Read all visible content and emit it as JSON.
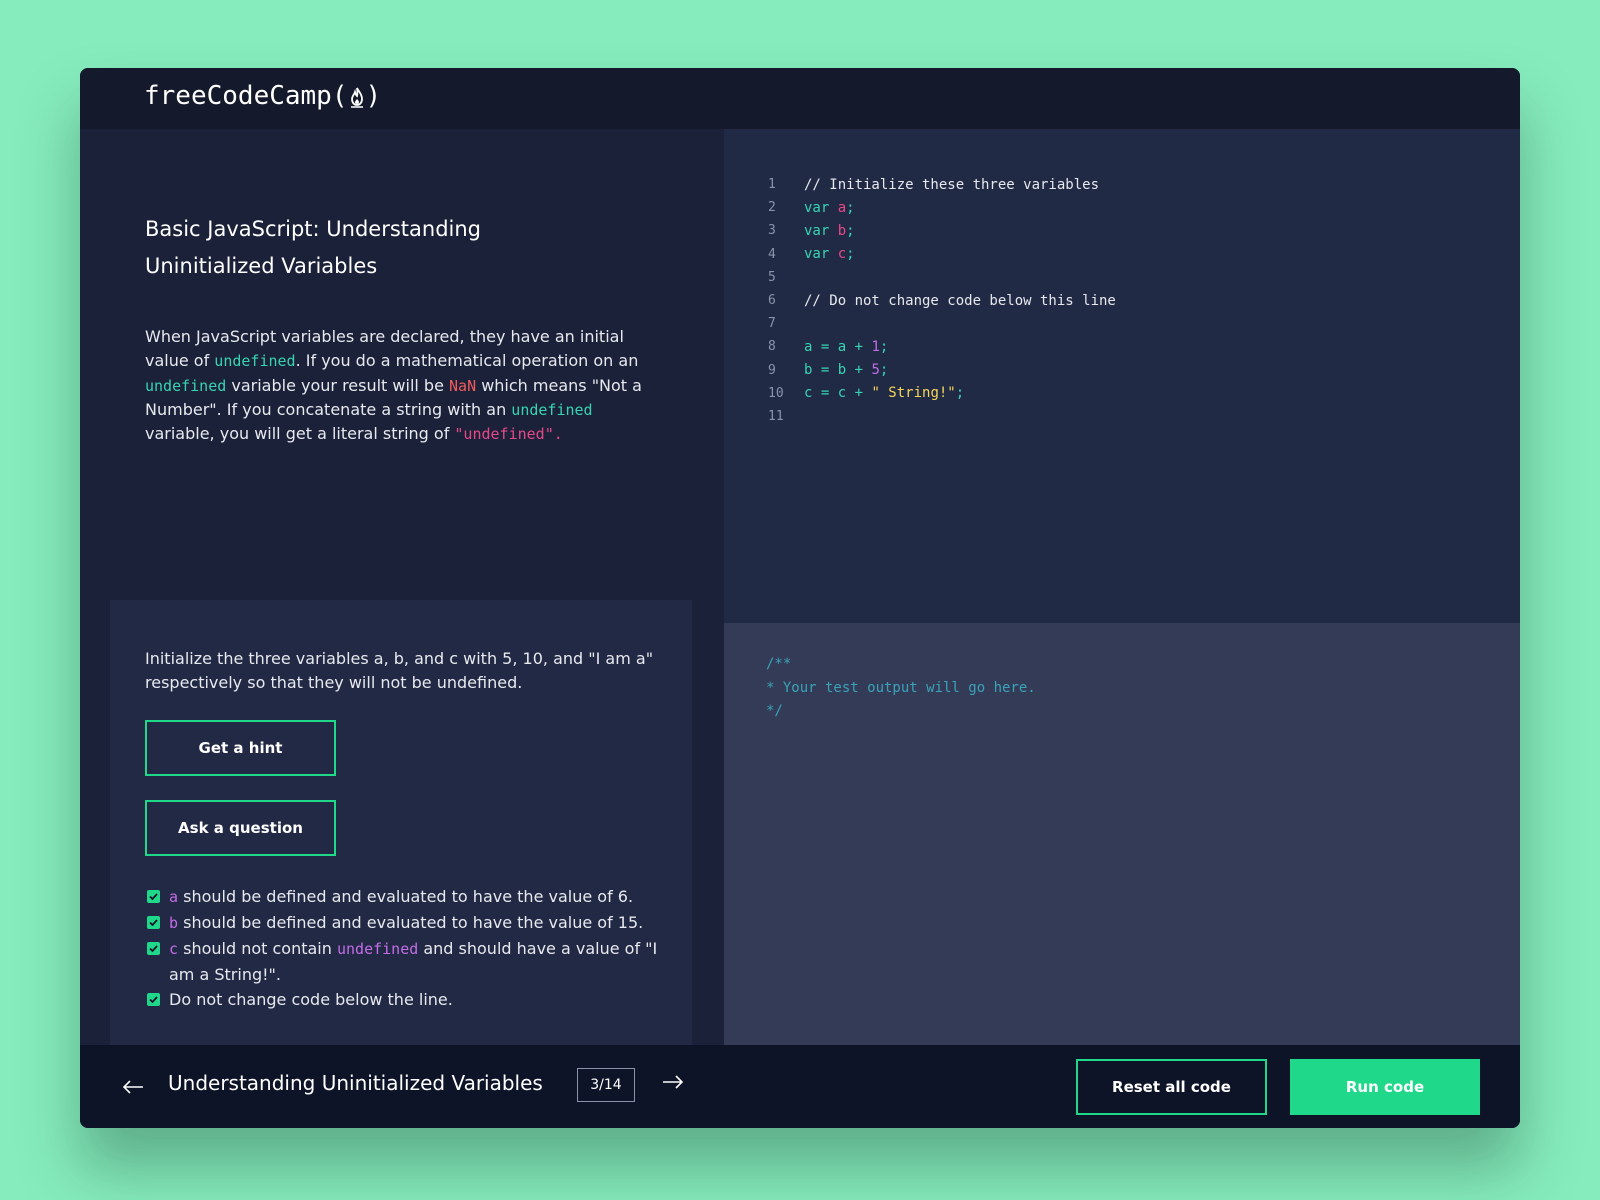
{
  "app": {
    "logo_text_before": "freeCodeCamp(",
    "logo_text_after": ")"
  },
  "lesson": {
    "title": "Basic JavaScript: Understanding Uninitialized Variables",
    "description": {
      "p1": "When JavaScript variables are declared, they have an initial value of ",
      "code1": "undefined",
      "p2": ". If you do a mathematical operation on an ",
      "code2": "undefined",
      "p3": " variable your result will be ",
      "code3": "NaN",
      "p4": " which means \"Not a Number\". If you concatenate a string with an ",
      "code4": "undefined",
      "p5": " variable, you will get a literal string of ",
      "code5": "\"undefined\"."
    },
    "task": "Initialize the three variables a, b, and c with 5, 10, and \"I am a\" respectively so that they will not be undefined.",
    "hint_button": "Get a hint",
    "ask_button": "Ask a question",
    "tests": [
      {
        "code": "a",
        "text": " should be defined and evaluated to have the value of 6."
      },
      {
        "code": "b",
        "text": " should be defined and evaluated to have the value of 15."
      },
      {
        "code": "c",
        "text": " should not contain ",
        "code2": "undefined",
        "text2": " and should have a value of \"I am a String!\"."
      },
      {
        "text": "Do not change code below the line."
      }
    ]
  },
  "editor": {
    "line_numbers": [
      "1",
      "2",
      "3",
      "4",
      "5",
      "6",
      "7",
      "8",
      "9",
      "10",
      "11"
    ],
    "lines": [
      "// Initialize these three variables",
      "var a;",
      "var b;",
      "var c;",
      "",
      "// Do not change code below this line",
      "",
      "a = a + 1;",
      "b = b + 5;",
      "c = c + \" String!\";",
      ""
    ]
  },
  "output": {
    "text": "/**\n* Your test output will go here.\n*/"
  },
  "footer": {
    "lesson_name": "Understanding Uninitialized Variables",
    "progress": "3/14",
    "reset_button": "Reset all code",
    "run_button": "Run code"
  },
  "colors": {
    "accent": "#1fd88a",
    "background": "#86ecbd",
    "panel": "#1b2138"
  },
  "icons": [
    "flame-icon",
    "check-icon",
    "arrow-left-icon",
    "arrow-right-icon"
  ]
}
